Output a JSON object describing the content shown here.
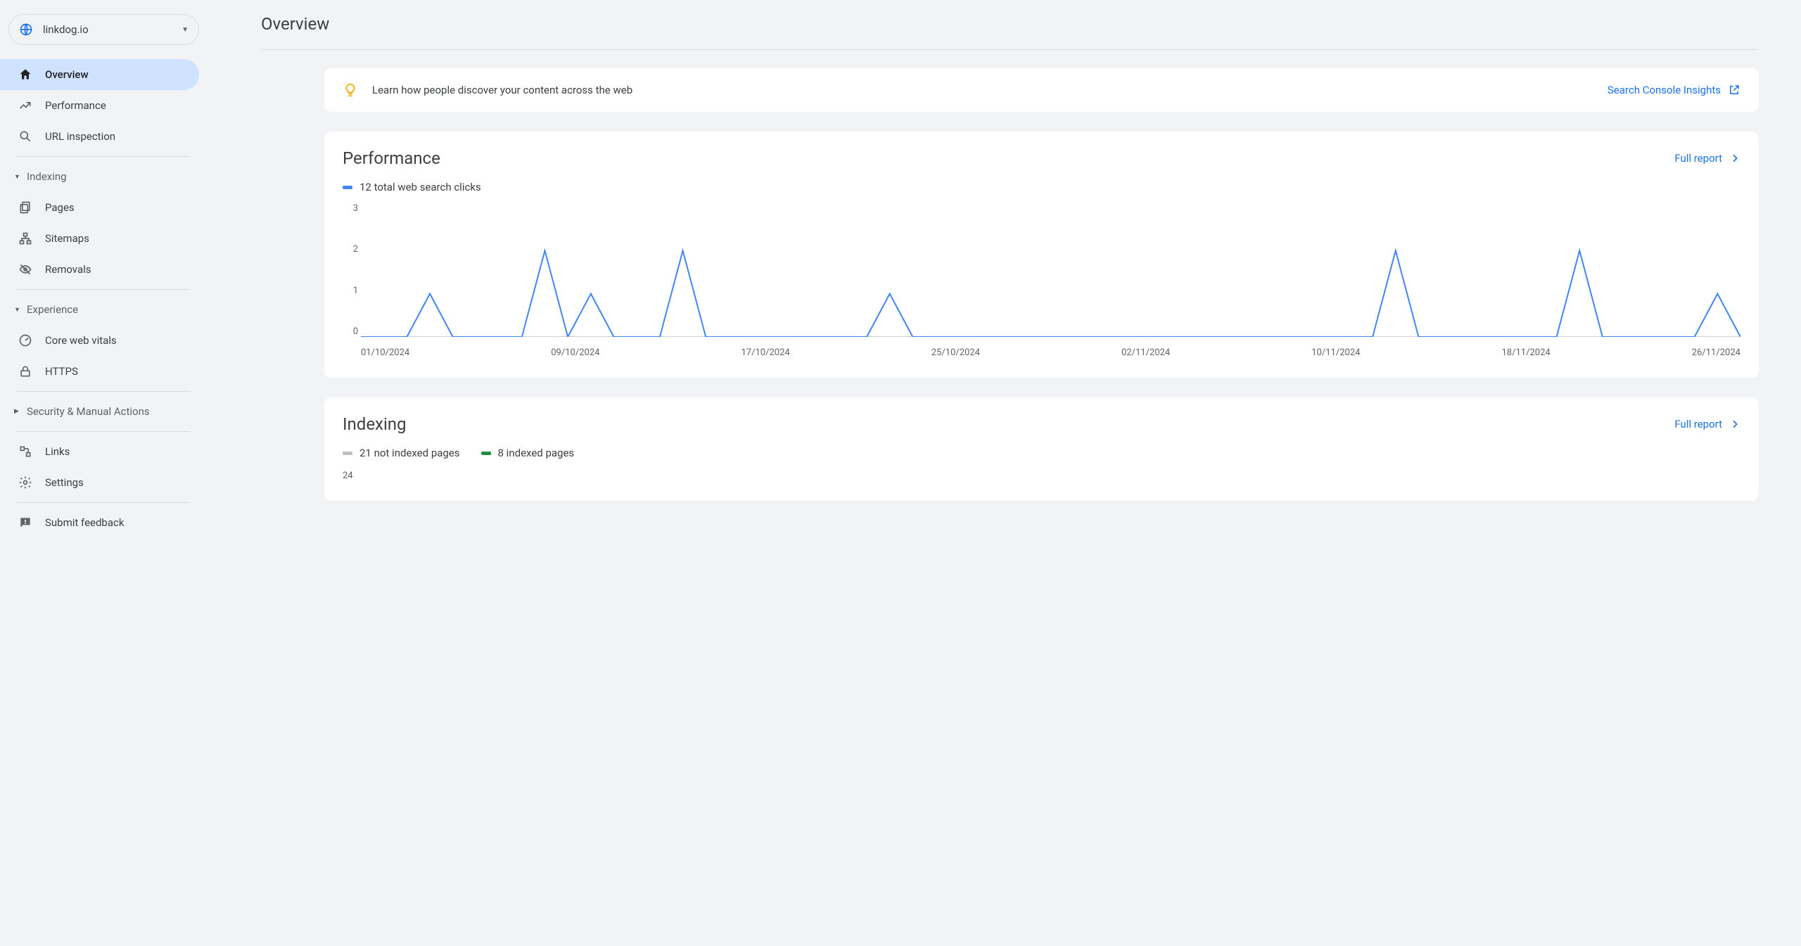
{
  "property": {
    "name": "linkdog.io"
  },
  "sidebar": {
    "items_top": [
      {
        "label": "Overview"
      },
      {
        "label": "Performance"
      },
      {
        "label": "URL inspection"
      }
    ],
    "sections": [
      {
        "label": "Indexing",
        "items": [
          {
            "label": "Pages"
          },
          {
            "label": "Sitemaps"
          },
          {
            "label": "Removals"
          }
        ]
      },
      {
        "label": "Experience",
        "items": [
          {
            "label": "Core web vitals"
          },
          {
            "label": "HTTPS"
          }
        ]
      },
      {
        "label": "Security & Manual Actions",
        "items": []
      }
    ],
    "items_bottom": [
      {
        "label": "Links"
      },
      {
        "label": "Settings"
      }
    ],
    "feedback": {
      "label": "Submit feedback"
    }
  },
  "page": {
    "title": "Overview"
  },
  "insight": {
    "text": "Learn how people discover your content across the web",
    "link": "Search Console Insights"
  },
  "performance": {
    "title": "Performance",
    "full_report": "Full report",
    "legend": "12 total web search clicks",
    "y_ticks": [
      "3",
      "2",
      "1",
      "0"
    ],
    "x_ticks": [
      "01/10/2024",
      "09/10/2024",
      "17/10/2024",
      "25/10/2024",
      "02/11/2024",
      "10/11/2024",
      "18/11/2024",
      "26/11/2024"
    ]
  },
  "indexing": {
    "title": "Indexing",
    "full_report": "Full report",
    "legend_not_indexed": "21 not indexed pages",
    "legend_indexed": "8 indexed pages",
    "y_tick_top": "24"
  },
  "chart_data": [
    {
      "type": "line",
      "title": "Performance",
      "ylabel": "Clicks",
      "ylim": [
        0,
        3
      ],
      "x": [
        "01/10/2024",
        "02/10/2024",
        "03/10/2024",
        "04/10/2024",
        "05/10/2024",
        "06/10/2024",
        "07/10/2024",
        "08/10/2024",
        "09/10/2024",
        "10/10/2024",
        "11/10/2024",
        "12/10/2024",
        "13/10/2024",
        "14/10/2024",
        "15/10/2024",
        "16/10/2024",
        "17/10/2024",
        "18/10/2024",
        "19/10/2024",
        "20/10/2024",
        "21/10/2024",
        "22/10/2024",
        "23/10/2024",
        "24/10/2024",
        "25/10/2024",
        "26/10/2024",
        "27/10/2024",
        "28/10/2024",
        "29/10/2024",
        "30/10/2024",
        "31/10/2024",
        "01/11/2024",
        "02/11/2024",
        "03/11/2024",
        "04/11/2024",
        "05/11/2024",
        "06/11/2024",
        "07/11/2024",
        "08/11/2024",
        "09/11/2024",
        "10/11/2024",
        "11/11/2024",
        "12/11/2024",
        "13/11/2024",
        "14/11/2024",
        "15/11/2024",
        "16/11/2024",
        "17/11/2024",
        "18/11/2024",
        "19/11/2024",
        "20/11/2024",
        "21/11/2024",
        "22/11/2024",
        "23/11/2024",
        "24/11/2024",
        "25/11/2024",
        "26/11/2024",
        "27/11/2024",
        "28/11/2024",
        "29/11/2024",
        "30/11/2024"
      ],
      "series": [
        {
          "name": "12 total web search clicks",
          "values": [
            0,
            0,
            0,
            1,
            0,
            0,
            0,
            0,
            2,
            0,
            1,
            0,
            0,
            0,
            2,
            0,
            0,
            0,
            0,
            0,
            0,
            0,
            0,
            1,
            0,
            0,
            0,
            0,
            0,
            0,
            0,
            0,
            0,
            0,
            0,
            0,
            0,
            0,
            0,
            0,
            0,
            0,
            0,
            0,
            0,
            2,
            0,
            0,
            0,
            0,
            0,
            0,
            0,
            2,
            0,
            0,
            0,
            0,
            0,
            1,
            0
          ]
        }
      ]
    }
  ]
}
